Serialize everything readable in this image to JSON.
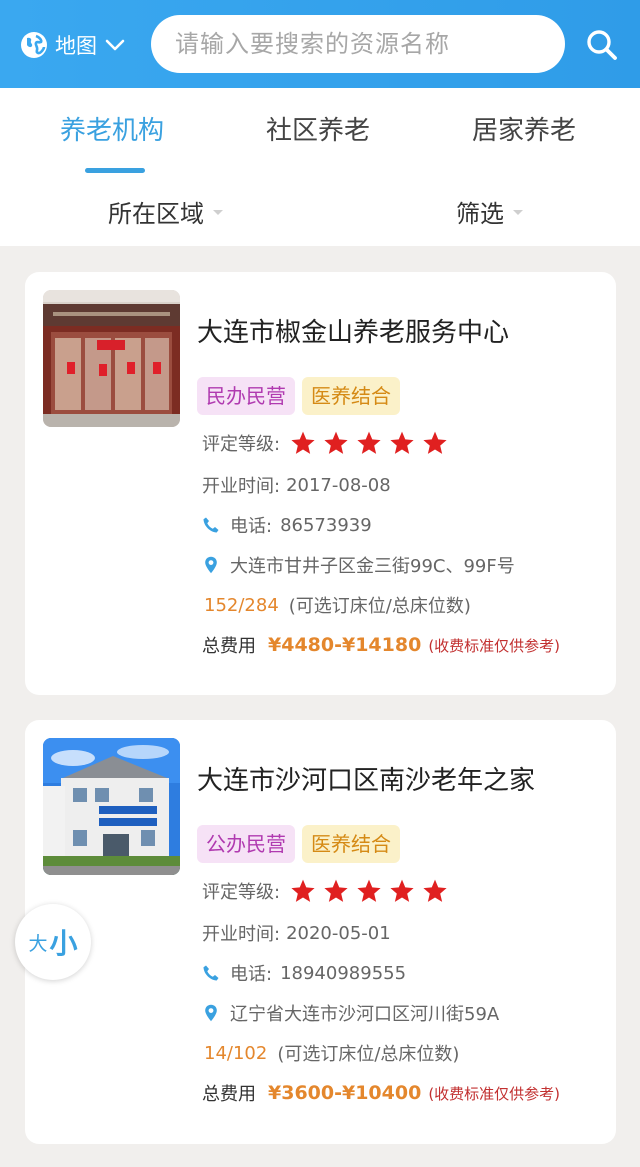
{
  "header": {
    "map_label": "地图",
    "search_placeholder": "请输入要搜索的资源名称"
  },
  "tabs": [
    {
      "label": "养老机构",
      "active": true
    },
    {
      "label": "社区养老",
      "active": false
    },
    {
      "label": "居家养老",
      "active": false
    }
  ],
  "filters": {
    "region": "所在区域",
    "filter": "筛选"
  },
  "labels": {
    "rating": "评定等级:",
    "opening": "开业时间:",
    "phone": "电话:",
    "beds_note": "(可选订床位/总床位数)",
    "fee": "总费用",
    "fee_note": "(收费标准仅供参考)"
  },
  "institutions": [
    {
      "name": "大连市椒金山养老服务中心",
      "tags": [
        "民办民营",
        "医养结合"
      ],
      "rating": 5,
      "opening_date": "2017-08-08",
      "phone": "86573939",
      "address": "大连市甘井子区金三街99C、99F号",
      "beds": "152/284",
      "fee": "¥4480-¥14180"
    },
    {
      "name": "大连市沙河口区南沙老年之家",
      "tags": [
        "公办民营",
        "医养结合"
      ],
      "rating": 5,
      "opening_date": "2020-05-01",
      "phone": "18940989555",
      "address": "辽宁省大连市沙河口区河川街59A",
      "beds": "14/102",
      "fee": "¥3600-¥10400"
    }
  ],
  "fontsize_toggle": {
    "big": "大",
    "small": "小"
  },
  "colors": {
    "header": "#3aa8f0",
    "accent": "#3aa1e0",
    "star": "#e02020",
    "fee": "#e4872d"
  }
}
